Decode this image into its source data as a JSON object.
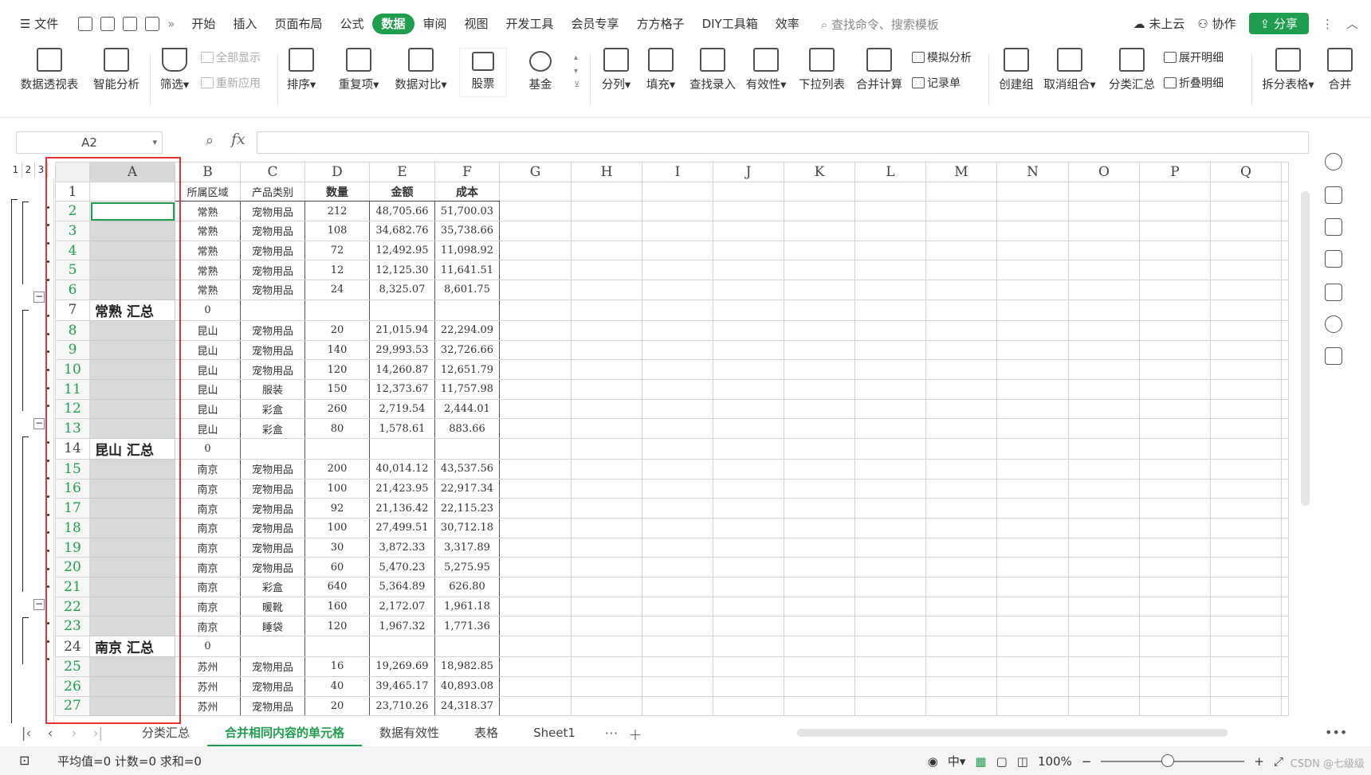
{
  "menu": {
    "file": "文件",
    "tabs": [
      "开始",
      "插入",
      "页面布局",
      "公式",
      "数据",
      "审阅",
      "视图",
      "开发工具",
      "会员专享",
      "方方格子",
      "DIY工具箱",
      "效率"
    ],
    "active": "数据",
    "search": "查找命令、搜索模板",
    "cloud": "未上云",
    "collab": "协作",
    "share": "分享"
  },
  "ribbon": {
    "pivot": "数据透视表",
    "smart": "智能分析",
    "filter": "筛选",
    "show_all": "全部显示",
    "reapply": "重新应用",
    "sort": "排序",
    "dup": "重复项",
    "compare": "数据对比",
    "stock": "股票",
    "fund": "基金",
    "split": "分列",
    "fill": "填充",
    "lookup": "查找录入",
    "valid": "有效性",
    "dropdown": "下拉列表",
    "consolidate": "合并计算",
    "simulate": "模拟分析",
    "record": "记录单",
    "group": "创建组",
    "ungroup": "取消组合",
    "subtotal": "分类汇总",
    "expand": "展开明细",
    "collapse": "折叠明细",
    "split_table": "拆分表格",
    "merge_table": "合并"
  },
  "formula": {
    "cell": "A2",
    "fx": "fx",
    "value": ""
  },
  "levels": [
    "1",
    "2",
    "3"
  ],
  "columns": [
    "A",
    "B",
    "C",
    "D",
    "E",
    "F",
    "G",
    "H",
    "I",
    "J",
    "K",
    "L",
    "M",
    "N",
    "O",
    "P",
    "Q"
  ],
  "header_row": {
    "num": "1",
    "b": "所属区域",
    "c": "产品类别",
    "d": "数量",
    "e": "金额",
    "f": "成本"
  },
  "rows": [
    {
      "num": "2",
      "a": "",
      "b": "常熟",
      "c": "宠物用品",
      "d": "212",
      "e": "48,705.66",
      "f": "51,700.03"
    },
    {
      "num": "3",
      "a": "",
      "b": "常熟",
      "c": "宠物用品",
      "d": "108",
      "e": "34,682.76",
      "f": "35,738.66"
    },
    {
      "num": "4",
      "a": "",
      "b": "常熟",
      "c": "宠物用品",
      "d": "72",
      "e": "12,492.95",
      "f": "11,098.92"
    },
    {
      "num": "5",
      "a": "",
      "b": "常熟",
      "c": "宠物用品",
      "d": "12",
      "e": "12,125.30",
      "f": "11,641.51"
    },
    {
      "num": "6",
      "a": "",
      "b": "常熟",
      "c": "宠物用品",
      "d": "24",
      "e": "8,325.07",
      "f": "8,601.75"
    },
    {
      "num": "7",
      "a": "常熟 汇总",
      "b": "0",
      "c": "",
      "d": "",
      "e": "",
      "f": ""
    },
    {
      "num": "8",
      "a": "",
      "b": "昆山",
      "c": "宠物用品",
      "d": "20",
      "e": "21,015.94",
      "f": "22,294.09"
    },
    {
      "num": "9",
      "a": "",
      "b": "昆山",
      "c": "宠物用品",
      "d": "140",
      "e": "29,993.53",
      "f": "32,726.66"
    },
    {
      "num": "10",
      "a": "",
      "b": "昆山",
      "c": "宠物用品",
      "d": "120",
      "e": "14,260.87",
      "f": "12,651.79"
    },
    {
      "num": "11",
      "a": "",
      "b": "昆山",
      "c": "服装",
      "d": "150",
      "e": "12,373.67",
      "f": "11,757.98"
    },
    {
      "num": "12",
      "a": "",
      "b": "昆山",
      "c": "彩盒",
      "d": "260",
      "e": "2,719.54",
      "f": "2,444.01"
    },
    {
      "num": "13",
      "a": "",
      "b": "昆山",
      "c": "彩盒",
      "d": "80",
      "e": "1,578.61",
      "f": "883.66"
    },
    {
      "num": "14",
      "a": "昆山 汇总",
      "b": "0",
      "c": "",
      "d": "",
      "e": "",
      "f": ""
    },
    {
      "num": "15",
      "a": "",
      "b": "南京",
      "c": "宠物用品",
      "d": "200",
      "e": "40,014.12",
      "f": "43,537.56"
    },
    {
      "num": "16",
      "a": "",
      "b": "南京",
      "c": "宠物用品",
      "d": "100",
      "e": "21,423.95",
      "f": "22,917.34"
    },
    {
      "num": "17",
      "a": "",
      "b": "南京",
      "c": "宠物用品",
      "d": "92",
      "e": "21,136.42",
      "f": "22,115.23"
    },
    {
      "num": "18",
      "a": "",
      "b": "南京",
      "c": "宠物用品",
      "d": "100",
      "e": "27,499.51",
      "f": "30,712.18"
    },
    {
      "num": "19",
      "a": "",
      "b": "南京",
      "c": "宠物用品",
      "d": "30",
      "e": "3,872.33",
      "f": "3,317.89"
    },
    {
      "num": "20",
      "a": "",
      "b": "南京",
      "c": "宠物用品",
      "d": "60",
      "e": "5,470.23",
      "f": "5,275.95"
    },
    {
      "num": "21",
      "a": "",
      "b": "南京",
      "c": "彩盒",
      "d": "640",
      "e": "5,364.89",
      "f": "626.80"
    },
    {
      "num": "22",
      "a": "",
      "b": "南京",
      "c": "暖靴",
      "d": "160",
      "e": "2,172.07",
      "f": "1,961.18"
    },
    {
      "num": "23",
      "a": "",
      "b": "南京",
      "c": "睡袋",
      "d": "120",
      "e": "1,967.32",
      "f": "1,771.36"
    },
    {
      "num": "24",
      "a": "南京 汇总",
      "b": "0",
      "c": "",
      "d": "",
      "e": "",
      "f": ""
    },
    {
      "num": "25",
      "a": "",
      "b": "苏州",
      "c": "宠物用品",
      "d": "16",
      "e": "19,269.69",
      "f": "18,982.85"
    },
    {
      "num": "26",
      "a": "",
      "b": "苏州",
      "c": "宠物用品",
      "d": "40",
      "e": "39,465.17",
      "f": "40,893.08"
    },
    {
      "num": "27",
      "a": "",
      "b": "苏州",
      "c": "宠物用品",
      "d": "20",
      "e": "23,710.26",
      "f": "24,318.37"
    }
  ],
  "sheet_tabs": [
    "分类汇总",
    "合并相同内容的单元格",
    "数据有效性",
    "表格",
    "Sheet1"
  ],
  "active_sheet": "合并相同内容的单元格",
  "status": {
    "stats": "平均值=0 计数=0 求和=0",
    "zoom": "100%"
  },
  "watermark": "CSDN @七级级",
  "colors": {
    "accent": "#1f9f4e",
    "highlight": "#e2333a"
  }
}
